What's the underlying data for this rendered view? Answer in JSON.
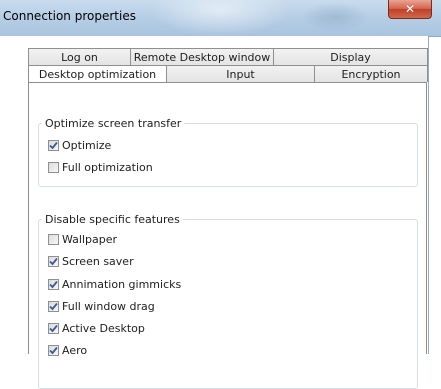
{
  "window": {
    "title": "Connection properties",
    "close_icon": "close-icon"
  },
  "tabs": {
    "row1": [
      {
        "label": "Log on"
      },
      {
        "label": "Remote Desktop window"
      },
      {
        "label": "Display"
      }
    ],
    "row2": [
      {
        "label": "Desktop optimization",
        "selected": true
      },
      {
        "label": "Input"
      },
      {
        "label": "Encryption"
      }
    ]
  },
  "optimize_group": {
    "legend": "Optimize screen transfer",
    "items": [
      {
        "label": "Optimize",
        "checked": true
      },
      {
        "label": "Full optimization",
        "checked": false
      }
    ]
  },
  "features_group": {
    "legend": "Disable specific features",
    "items": [
      {
        "label": "Wallpaper",
        "checked": false
      },
      {
        "label": "Screen saver",
        "checked": true
      },
      {
        "label": "Annimation gimmicks",
        "checked": true
      },
      {
        "label": "Full window drag",
        "checked": true
      },
      {
        "label": "Active Desktop",
        "checked": true
      },
      {
        "label": "Aero",
        "checked": true
      }
    ]
  },
  "colors": {
    "checkmark": "#3a5a9a",
    "titlebar": "#b7cfe6",
    "close_button": "#c9503a"
  }
}
